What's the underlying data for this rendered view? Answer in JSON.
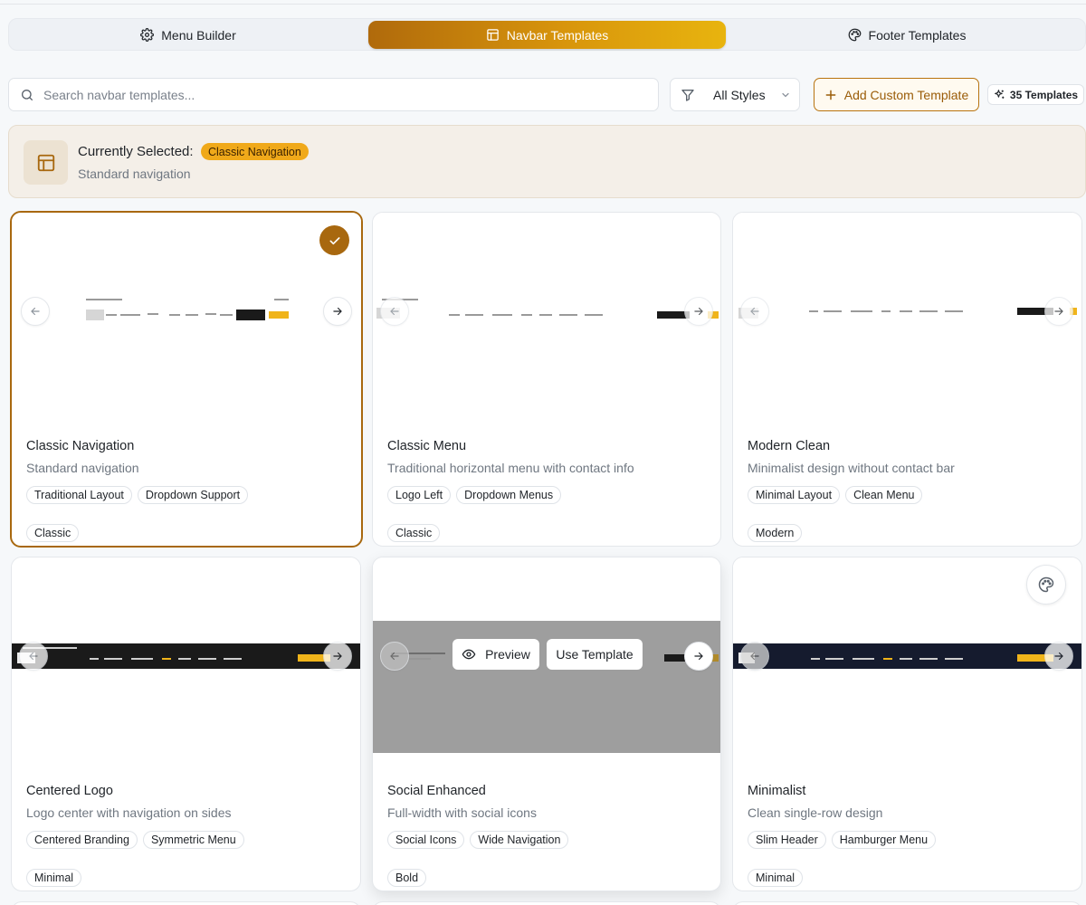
{
  "tabs": [
    {
      "label": "Menu Builder",
      "icon": "gear-icon",
      "active": false
    },
    {
      "label": "Navbar Templates",
      "icon": "layout-icon",
      "active": true
    },
    {
      "label": "Footer Templates",
      "icon": "palette-icon",
      "active": false
    }
  ],
  "toolbar": {
    "search_placeholder": "Search navbar templates...",
    "search_value": "",
    "filter_label": "All Styles",
    "add_label": "Add Custom Template",
    "count_label": "35 Templates"
  },
  "selected": {
    "prefix": "Currently Selected:",
    "name": "Classic Navigation",
    "description": "Standard navigation"
  },
  "colors": {
    "accent": "#a8680f",
    "accent_gold": "#f0a91a",
    "banner_bg": "#f4efe8"
  },
  "overlay": {
    "preview_label": "Preview",
    "use_label": "Use Template"
  },
  "cards": [
    {
      "title": "Classic Navigation",
      "description": "Standard navigation",
      "tags": [
        "Traditional Layout",
        "Dropdown Support"
      ],
      "category": "Classic",
      "selected": true
    },
    {
      "title": "Classic Menu",
      "description": "Traditional horizontal menu with contact info",
      "tags": [
        "Logo Left",
        "Dropdown Menus"
      ],
      "category": "Classic",
      "selected": false
    },
    {
      "title": "Modern Clean",
      "description": "Minimalist design without contact bar",
      "tags": [
        "Minimal Layout",
        "Clean Menu"
      ],
      "category": "Modern",
      "selected": false
    },
    {
      "title": "Centered Logo",
      "description": "Logo center with navigation on sides",
      "tags": [
        "Centered Branding",
        "Symmetric Menu"
      ],
      "category": "Minimal",
      "selected": false
    },
    {
      "title": "Social Enhanced",
      "description": "Full-width with social icons",
      "tags": [
        "Social Icons",
        "Wide Navigation"
      ],
      "category": "Bold",
      "selected": false
    },
    {
      "title": "Minimalist",
      "description": "Clean single-row design",
      "tags": [
        "Slim Header",
        "Hamburger Menu"
      ],
      "category": "Minimal",
      "selected": false
    }
  ]
}
